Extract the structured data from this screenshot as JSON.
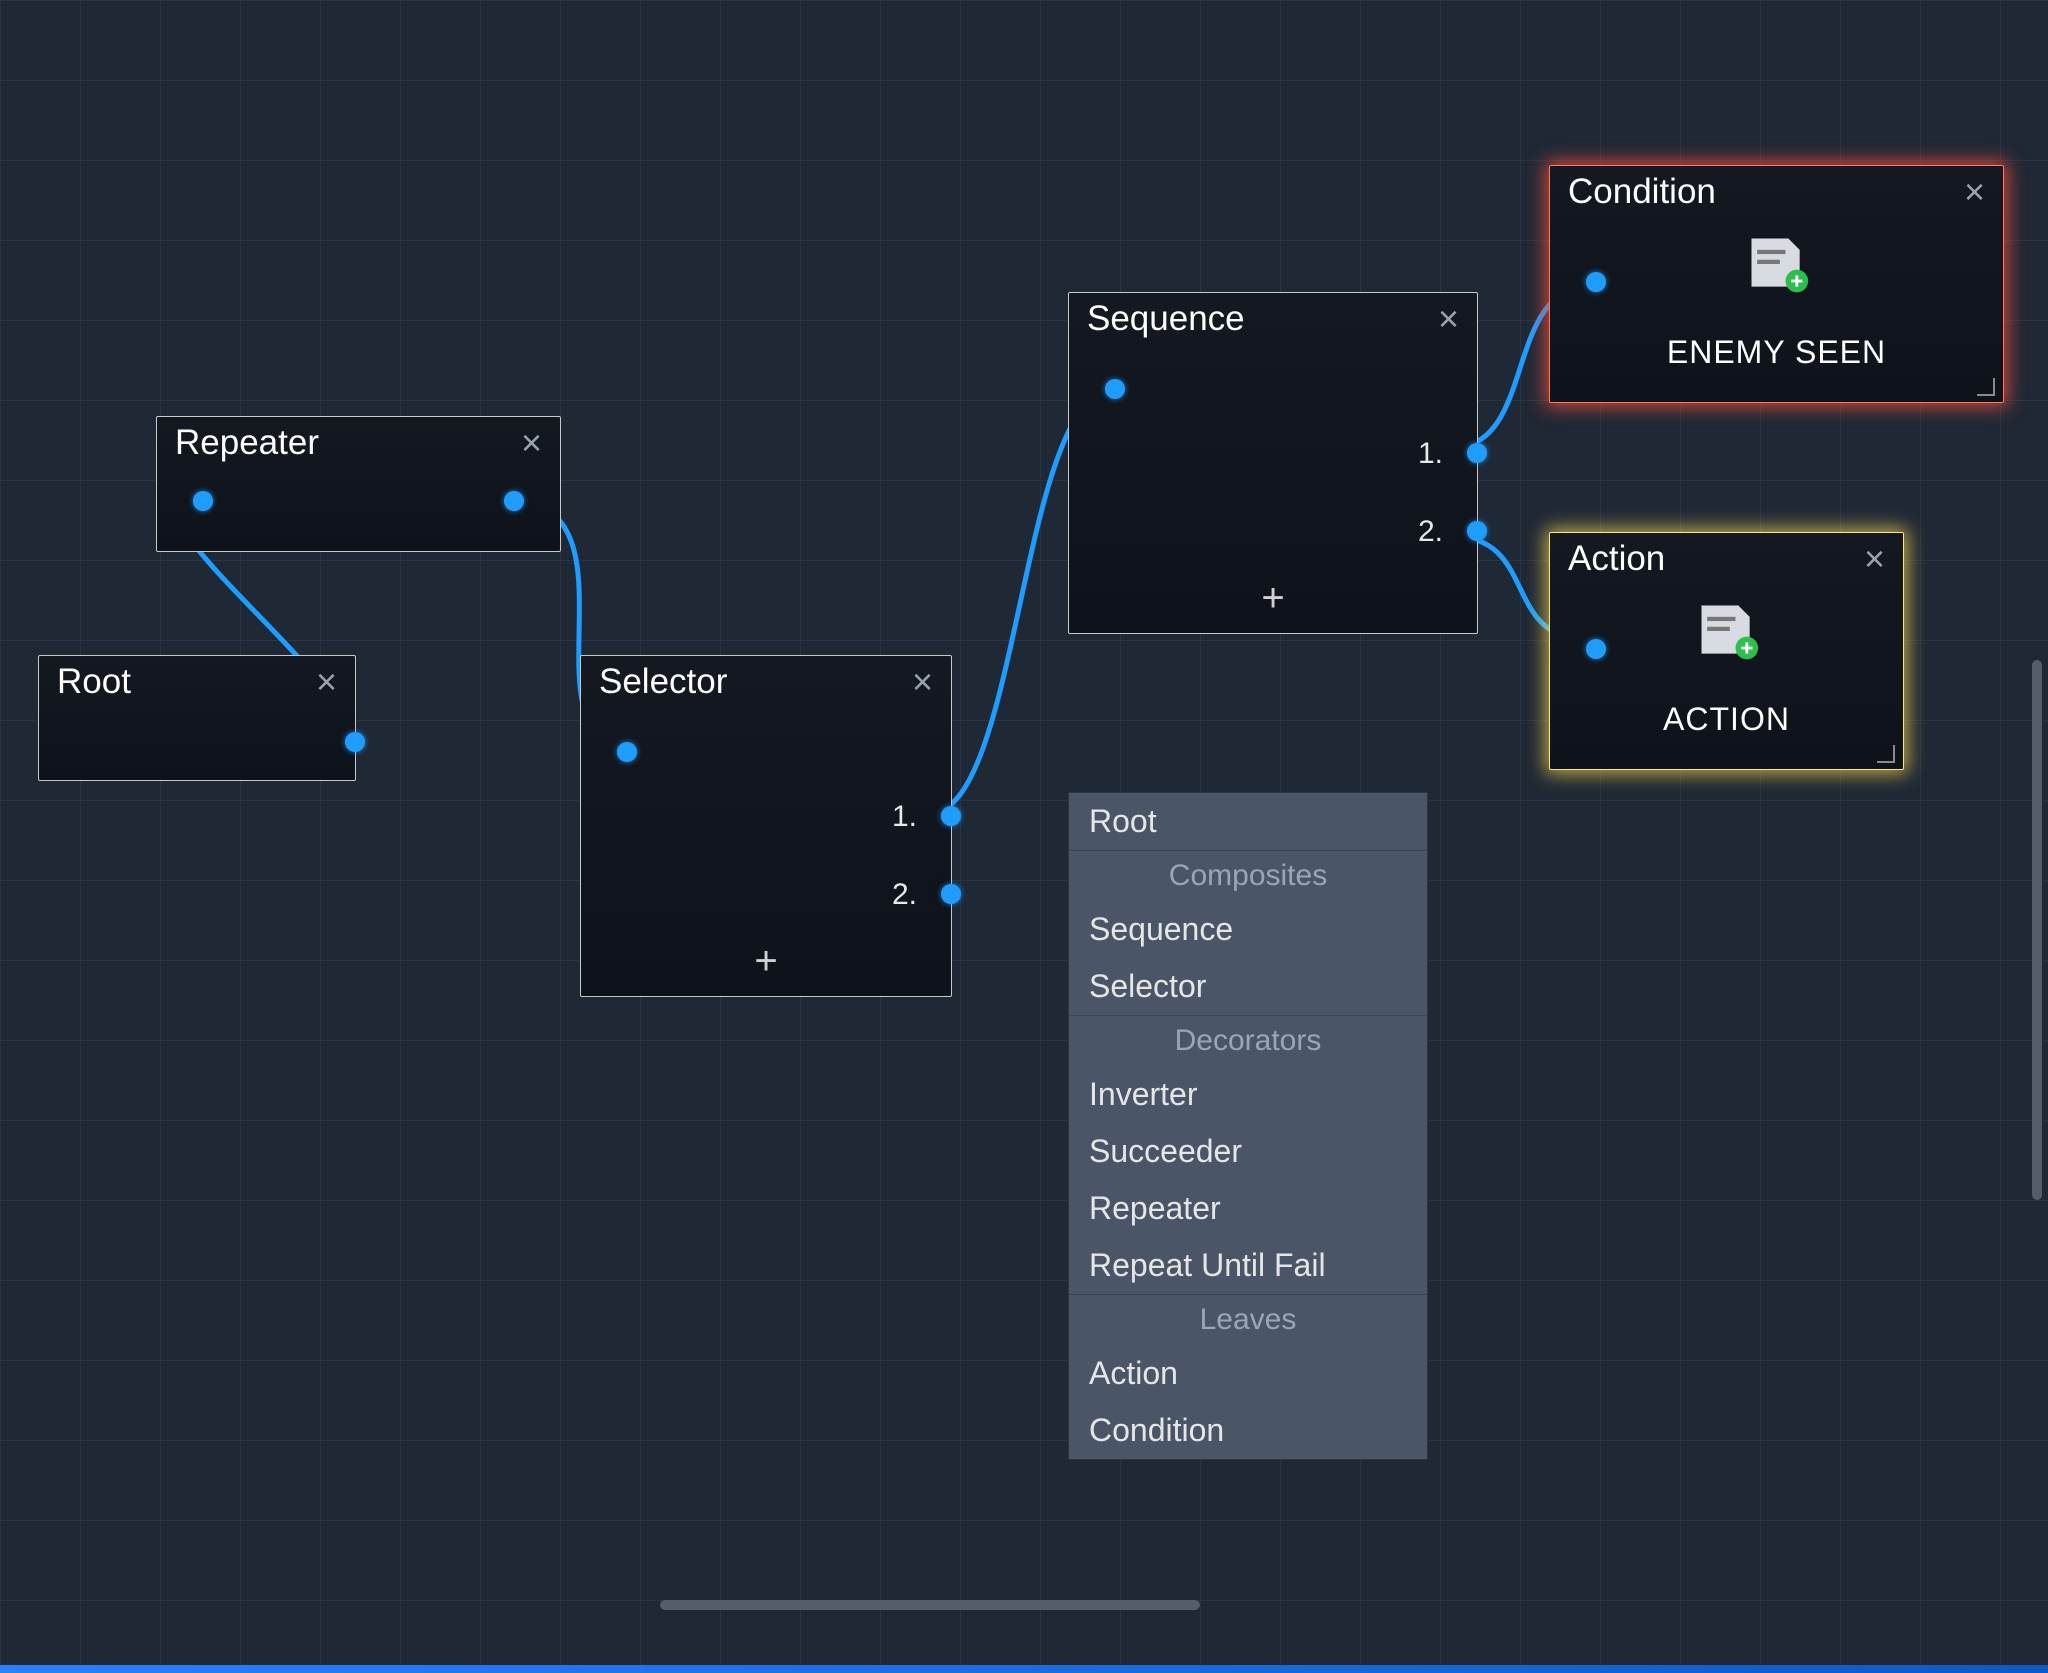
{
  "colors": {
    "port": "#1f9dff",
    "edge": "#1f9dff",
    "glow_red": "#ff7a5c",
    "glow_yellow": "#ffe47a"
  },
  "nodes": {
    "root": {
      "title": "Root"
    },
    "repeater": {
      "title": "Repeater"
    },
    "selector": {
      "title": "Selector",
      "slot1": "1.",
      "slot2": "2.",
      "add": "+"
    },
    "sequence": {
      "title": "Sequence",
      "slot1": "1.",
      "slot2": "2.",
      "add": "+"
    },
    "condition": {
      "title": "Condition",
      "value": "ENEMY SEEN"
    },
    "action": {
      "title": "Action",
      "value": "ACTION"
    }
  },
  "context_menu": {
    "root": "Root",
    "section1": "Composites",
    "sequence": "Sequence",
    "selector": "Selector",
    "section2": "Decorators",
    "inverter": "Inverter",
    "succeeder": "Succeeder",
    "repeater": "Repeater",
    "repeat_until_fail": "Repeat Until Fail",
    "section3": "Leaves",
    "action": "Action",
    "condition": "Condition"
  }
}
